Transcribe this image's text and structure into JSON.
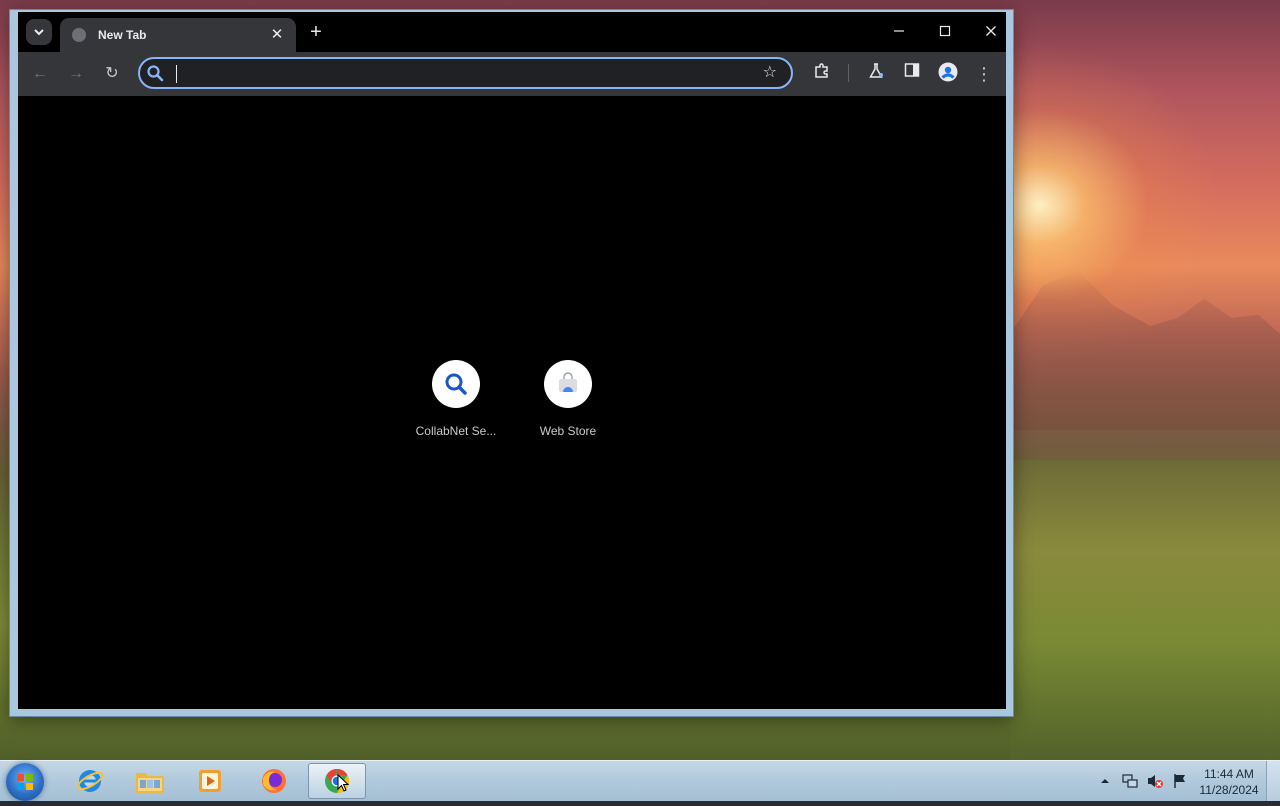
{
  "browser": {
    "tab": {
      "title": "New Tab",
      "close_glyph": "✕"
    },
    "new_tab_glyph": "+",
    "window_controls": {
      "minimize": "—",
      "maximize": "☐",
      "close": "✕"
    },
    "toolbar": {
      "back": "←",
      "forward": "→",
      "reload": "↻",
      "star": "☆",
      "menu": "⋮"
    },
    "omnibox": {
      "value": "",
      "placeholder": ""
    },
    "shortcuts": [
      {
        "label": "CollabNet Se...",
        "icon": "search-icon"
      },
      {
        "label": "Web Store",
        "icon": "web-store-icon"
      }
    ]
  },
  "taskbar": {
    "apps": [
      "internet-explorer",
      "file-explorer",
      "media-player",
      "firefox",
      "chrome"
    ],
    "clock": {
      "time": "11:44 AM",
      "date": "11/28/2024"
    }
  },
  "colors": {
    "accent": "#8ab4f8",
    "tab_bg": "#35363a",
    "content_bg": "#000000"
  }
}
